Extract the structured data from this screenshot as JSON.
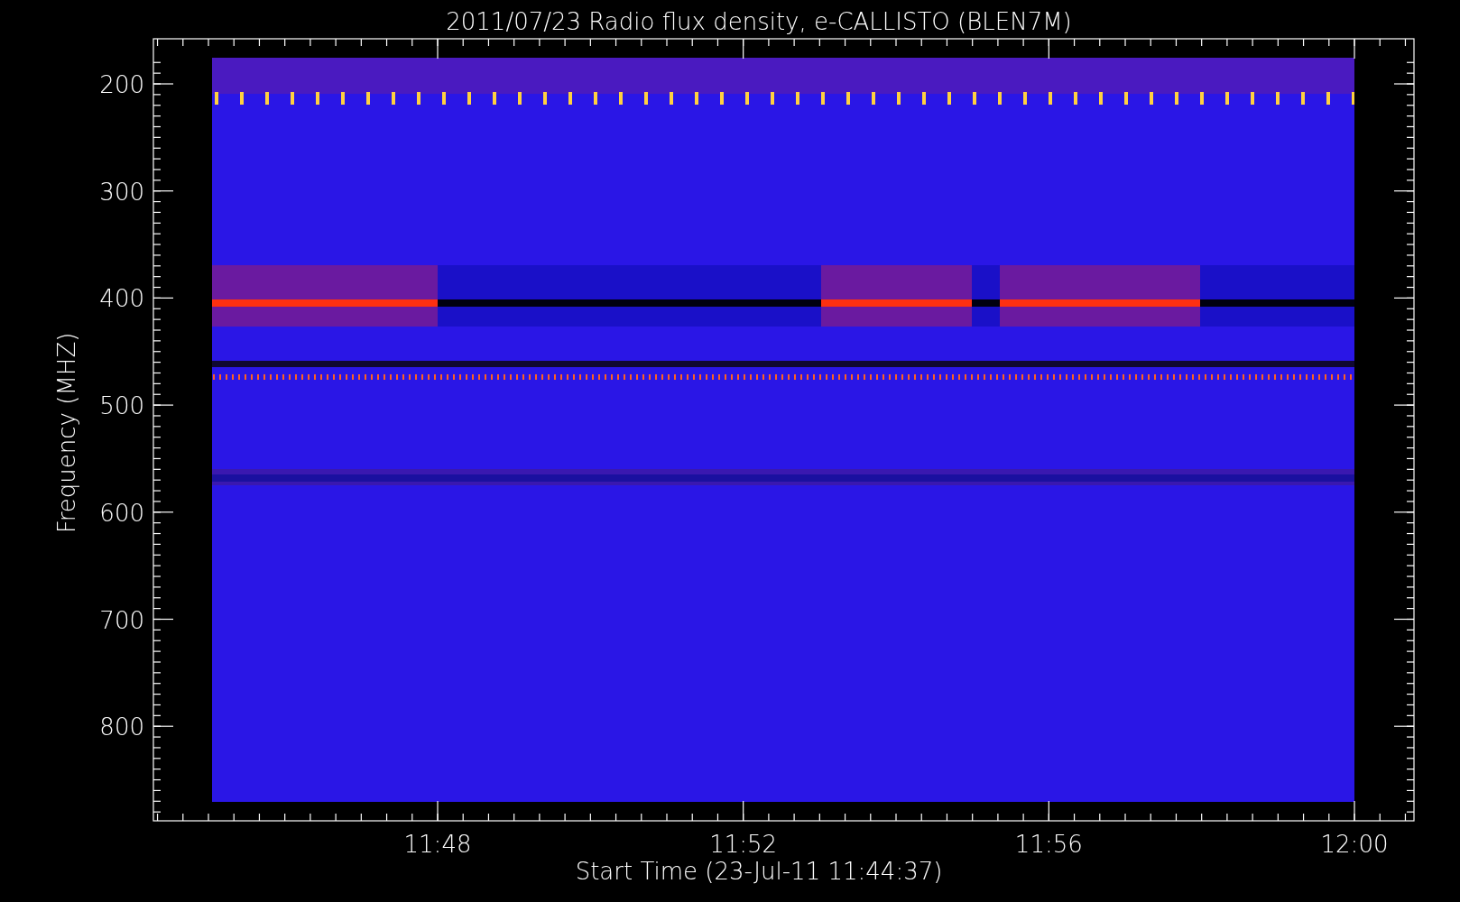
{
  "plot": {
    "title": "2011/07/23  Radio flux density, e-CALLISTO (BLEN7M)",
    "ylabel": "Frequency (MHZ)",
    "xlabel": "Start Time (23-Jul-11 11:44:37)",
    "y_tick_labels": [
      "200",
      "300",
      "400",
      "500",
      "600",
      "700",
      "800"
    ],
    "x_tick_labels": [
      "11:48",
      "11:52",
      "11:56",
      "12:00"
    ]
  }
}
